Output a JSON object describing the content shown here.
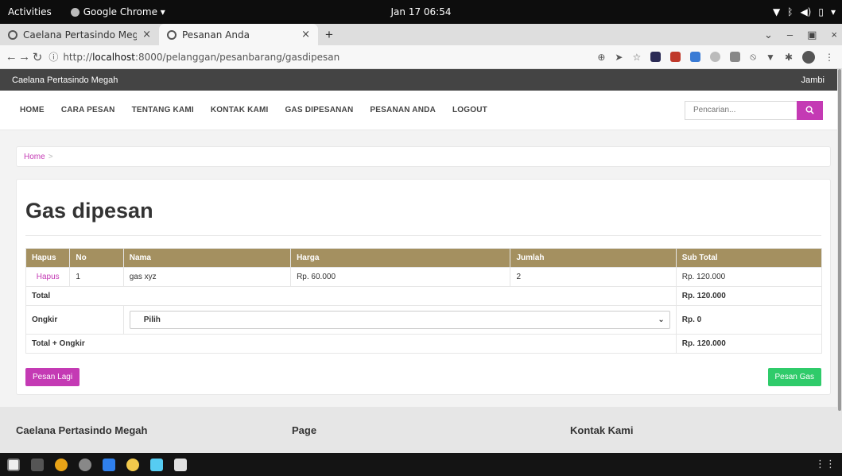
{
  "topbar": {
    "activities": "Activities",
    "app_name": "Google Chrome ▾",
    "clock": "Jan 17  06:54"
  },
  "tabs": [
    {
      "label": "Caelana Pertasindo Mega"
    },
    {
      "label": "Pesanan Anda"
    }
  ],
  "address": {
    "prefix": "http://",
    "host": "localhost",
    "path": ":8000/pelanggan/pesanbarang/gasdipesan"
  },
  "site": {
    "brand": "Caelana Pertasindo Megah",
    "city": "Jambi",
    "menu": [
      "HOME",
      "CARA PESAN",
      "TENTANG KAMI",
      "KONTAK KAMI",
      "GAS DIPESANAN",
      "PESANAN ANDA",
      "LOGOUT"
    ],
    "search_placeholder": "Pencarian..."
  },
  "breadcrumb": {
    "home": "Home",
    "separator": ">"
  },
  "content": {
    "title": "Gas dipesan",
    "columns": [
      "Hapus",
      "No",
      "Nama",
      "Harga",
      "Jumlah",
      "Sub Total"
    ],
    "rows": [
      {
        "hapus": "Hapus",
        "no": "1",
        "nama": "gas xyz",
        "harga": "Rp. 60.000",
        "jumlah": "2",
        "subtotal": "Rp. 120.000"
      }
    ],
    "total_label": "Total",
    "total_value": "Rp. 120.000",
    "ongkir_label": "Ongkir",
    "ongkir_select": "Pilih",
    "ongkir_value": "Rp. 0",
    "grand_label": "Total + Ongkir",
    "grand_value": "Rp. 120.000",
    "btn_pesan_lagi": "Pesan Lagi",
    "btn_pesan_gas": "Pesan Gas"
  },
  "footer": {
    "col1": "Caelana Pertasindo Megah",
    "col2": "Page",
    "col3": "Kontak Kami"
  },
  "colors": {
    "accent": "#c43ab4",
    "table_header": "#a49060",
    "success": "#2fcb6a",
    "site_topbar": "#444444"
  }
}
